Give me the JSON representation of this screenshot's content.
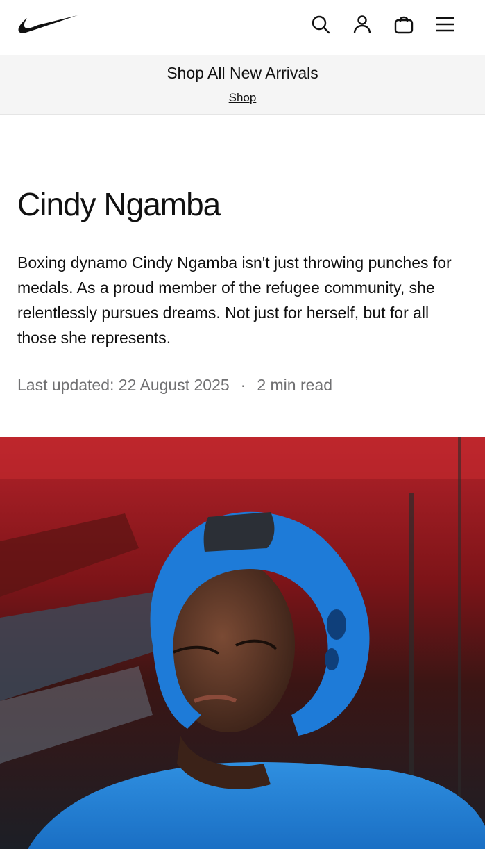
{
  "header": {
    "logo": "swoosh-logo",
    "icons": [
      "search-icon",
      "user-icon",
      "bag-icon",
      "menu-icon"
    ]
  },
  "promo": {
    "title": "Shop All New Arrivals",
    "link": "Shop"
  },
  "article": {
    "title": "Cindy Ngamba",
    "intro": "Boxing dynamo Cindy Ngamba isn't just throwing punches for medals. As a proud member of the refugee community, she relentlessly pursues dreams. Not just for herself, but for all those she represents.",
    "last_updated": "Last updated: 22 August 2025",
    "separator": "·",
    "read_time": "2 min read"
  },
  "colors": {
    "text": "#111111",
    "muted": "#707072",
    "promo_bg": "#f5f5f5",
    "headgear_blue": "#1e7bd8"
  }
}
